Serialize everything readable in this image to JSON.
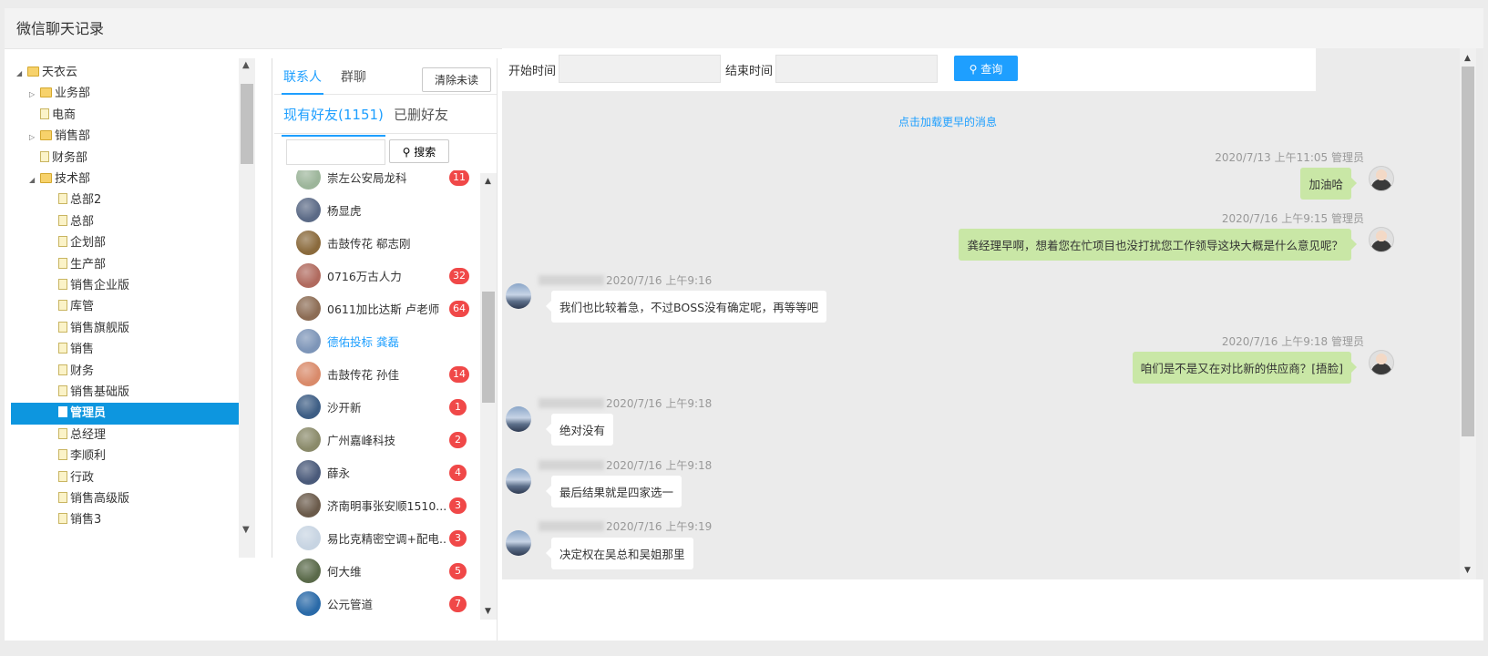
{
  "window": {
    "title": "微信聊天记录"
  },
  "tree": {
    "items": [
      {
        "label": "天衣云",
        "type": "folder",
        "expanded": true,
        "level": 0
      },
      {
        "label": "业务部",
        "type": "folder",
        "expanded": false,
        "level": 1
      },
      {
        "label": "电商",
        "type": "file",
        "level": 1
      },
      {
        "label": "销售部",
        "type": "folder",
        "expanded": false,
        "level": 1
      },
      {
        "label": "财务部",
        "type": "file",
        "level": 1
      },
      {
        "label": "技术部",
        "type": "folder",
        "expanded": true,
        "level": 1
      },
      {
        "label": "总部2",
        "type": "file",
        "level": 2
      },
      {
        "label": "总部",
        "type": "file",
        "level": 2
      },
      {
        "label": "企划部",
        "type": "file",
        "level": 2
      },
      {
        "label": "生产部",
        "type": "file",
        "level": 2
      },
      {
        "label": "销售企业版",
        "type": "file",
        "level": 2
      },
      {
        "label": "库管",
        "type": "file",
        "level": 2
      },
      {
        "label": "销售旗舰版",
        "type": "file",
        "level": 2
      },
      {
        "label": "销售",
        "type": "file",
        "level": 2
      },
      {
        "label": "财务",
        "type": "file",
        "level": 2
      },
      {
        "label": "销售基础版",
        "type": "file",
        "level": 2
      },
      {
        "label": "管理员",
        "type": "file",
        "level": 2,
        "selected": true
      },
      {
        "label": "总经理",
        "type": "file",
        "level": 2
      },
      {
        "label": "李顺利",
        "type": "file",
        "level": 2
      },
      {
        "label": "行政",
        "type": "file",
        "level": 2
      },
      {
        "label": "销售高级版",
        "type": "file",
        "level": 2
      },
      {
        "label": "销售3",
        "type": "file",
        "level": 2
      }
    ]
  },
  "contacts_panel": {
    "tabs": [
      "联系人",
      "群聊"
    ],
    "clear_unread_label": "清除未读",
    "subtabs": [
      "现有好友(1151)",
      "已删好友"
    ],
    "search_label": "搜索",
    "contacts": [
      {
        "name": "崇左公安局龙科",
        "badge": "11",
        "avatar_color": "#9cb59a"
      },
      {
        "name": "杨显虎",
        "badge": "",
        "avatar_color": "#5b6a86"
      },
      {
        "name": "击鼓传花 郗志刚",
        "badge": "",
        "avatar_color": "#8a6a3c"
      },
      {
        "name": "0716万古人力",
        "badge": "32",
        "avatar_color": "#b06a5e"
      },
      {
        "name": "0611加比达斯 卢老师",
        "badge": "64",
        "avatar_color": "#8c6c54"
      },
      {
        "name": "德佑投标 龚磊",
        "badge": "",
        "avatar_color": "#7d95b8",
        "highlight": true
      },
      {
        "name": "击鼓传花 孙佳",
        "badge": "14",
        "avatar_color": "#d98a6a"
      },
      {
        "name": "沙开新",
        "badge": "1",
        "avatar_color": "#3d5d84"
      },
      {
        "name": "广州嘉峰科技",
        "badge": "2",
        "avatar_color": "#8a8a6a"
      },
      {
        "name": "薛永",
        "badge": "4",
        "avatar_color": "#4a5a7a"
      },
      {
        "name": "济南明事张安顺1510...",
        "badge": "3",
        "avatar_color": "#6a5a4a"
      },
      {
        "name": "易比克精密空调+配电...",
        "badge": "3",
        "avatar_color": "#c7d4e2"
      },
      {
        "name": "何大维",
        "badge": "5",
        "avatar_color": "#5a6a4a"
      },
      {
        "name": "公元管道",
        "badge": "7",
        "avatar_color": "#2a6aa8"
      }
    ]
  },
  "chat": {
    "filter": {
      "start_label": "开始时间",
      "end_label": "结束时间",
      "query_label": "查询"
    },
    "load_more": "点击加载更早的消息",
    "messages": [
      {
        "from": "me",
        "meta": "2020/7/13 上午11:05 管理员",
        "text": "加油哈"
      },
      {
        "from": "me",
        "meta": "2020/7/16 上午9:15 管理员",
        "text": "龚经理早啊，想着您在忙项目也没打扰您工作领导这块大概是什么意见呢？"
      },
      {
        "from": "other",
        "meta": "2020/7/16 上午9:16",
        "text": "我们也比较着急，不过BOSS没有确定呢，再等等吧"
      },
      {
        "from": "me",
        "meta": "2020/7/16 上午9:18 管理员",
        "text": "咱们是不是又在对比新的供应商？[捂脸]"
      },
      {
        "from": "other",
        "meta": "2020/7/16 上午9:18",
        "text": "绝对没有"
      },
      {
        "from": "other",
        "meta": "2020/7/16 上午9:18",
        "text": "最后结果就是四家选一"
      },
      {
        "from": "other",
        "meta": "2020/7/16 上午9:19",
        "text": "决定权在吴总和吴姐那里"
      }
    ]
  }
}
